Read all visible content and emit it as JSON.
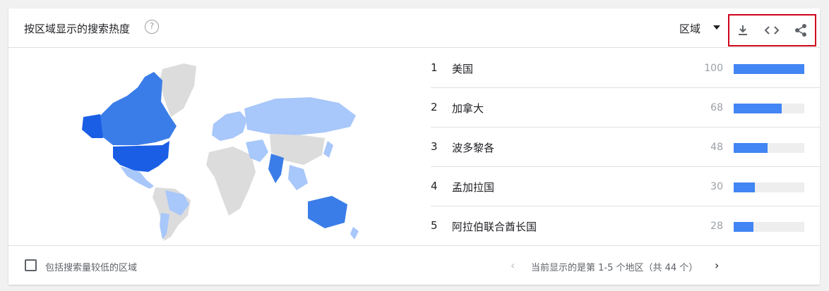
{
  "header": {
    "title": "按区域显示的搜索热度",
    "help_glyph": "?",
    "region_label": "区域"
  },
  "toolbar": {
    "download_icon": "download-icon",
    "embed_icon": "embed-code-icon",
    "share_icon": "share-icon",
    "highlight_color": "#d0021b"
  },
  "map": {
    "colors": {
      "high": "#1a5ee6",
      "mid": "#3b7de8",
      "low": "#a8c7fa",
      "none": "#dcdcdc"
    }
  },
  "rankings": [
    {
      "rank": "1",
      "name": "美国",
      "value": "100",
      "fill": 1.0
    },
    {
      "rank": "2",
      "name": "加拿大",
      "value": "68",
      "fill": 0.68
    },
    {
      "rank": "3",
      "name": "波多黎各",
      "value": "48",
      "fill": 0.48
    },
    {
      "rank": "4",
      "name": "孟加拉国",
      "value": "30",
      "fill": 0.3
    },
    {
      "rank": "5",
      "name": "阿拉伯联合酋长国",
      "value": "28",
      "fill": 0.28
    }
  ],
  "footer": {
    "include_low_label": "包括搜索量较低的区域",
    "prev_glyph": "‹",
    "next_glyph": "›",
    "page_info": "当前显示的是第 1-5 个地区（共 44 个）"
  }
}
